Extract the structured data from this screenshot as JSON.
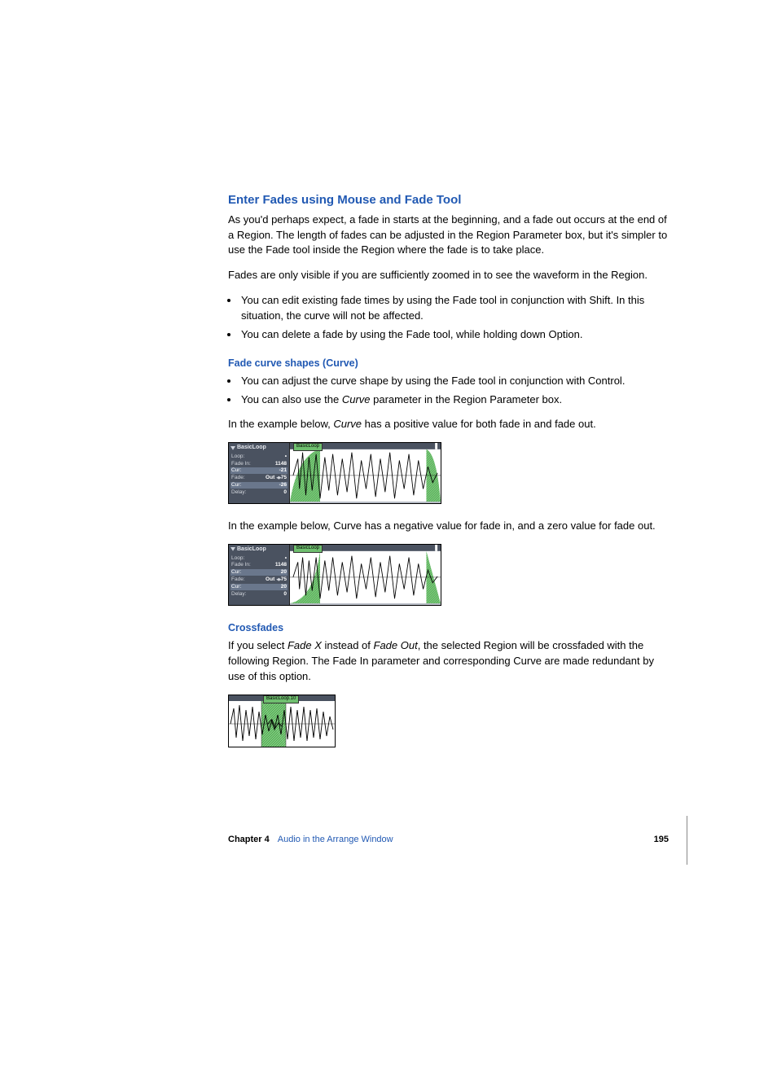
{
  "heading": "Enter Fades using Mouse and Fade Tool",
  "para1": "As you'd perhaps expect, a fade in starts at the beginning, and a fade out occurs at the end of a Region. The length of fades can be adjusted in the Region Parameter box, but it's simpler to use the Fade tool inside the Region where the fade is to take place.",
  "para2": "Fades are only visible if you are sufficiently zoomed in to see the waveform in the Region.",
  "bullets1": [
    "You can edit existing fade times by using the Fade tool in conjunction with Shift. In this situation, the curve will not be affected.",
    "You can delete a fade by using the Fade tool, while holding down Option."
  ],
  "sub1": "Fade curve shapes (Curve)",
  "bullets2_a": "You can adjust the curve shape by using the Fade tool in conjunction with Control.",
  "bullets2_b_pre": "You can also use the ",
  "bullets2_b_em": "Curve",
  "bullets2_b_post": " parameter in the Region Parameter box.",
  "para3_pre": "In the example below, ",
  "para3_em": "Curve",
  "para3_post": " has a positive value for both fade in and fade out.",
  "para4": "In the example below, Curve has a negative value for fade in, and a zero value for fade out.",
  "sub2": "Crossfades",
  "para5_a": "If you select ",
  "para5_b": "Fade X",
  "para5_c": " instead of ",
  "para5_d": "Fade Out",
  "para5_e": ", the selected Region will be crossfaded with the following Region. The Fade In parameter and corresponding Curve are made redundant by use of this option.",
  "fig1": {
    "panel_title": "BasicLoop",
    "region_tab": "BasicLoop",
    "rows": {
      "loop_l": "Loop:",
      "loop_v": "•",
      "fadein_l": "Fade In:",
      "fadein_v": "1148",
      "cur1_l": "Cur:",
      "cur1_v": "-21",
      "fade_l": "Fade:",
      "fade_v": "Out",
      "fade_num": "75",
      "cur2_l": "Cur:",
      "cur2_v": "-26",
      "delay_l": "Delay:",
      "delay_v": "0"
    }
  },
  "fig2": {
    "panel_title": "BasicLoop",
    "region_tab": "BasicLoop",
    "rows": {
      "loop_l": "Loop:",
      "loop_v": "•",
      "fadein_l": "Fade In:",
      "fadein_v": "1148",
      "cur1_l": "Cur:",
      "cur1_v": "20",
      "fade_l": "Fade:",
      "fade_v": "Out",
      "fade_num": "75",
      "cur2_l": "Cur:",
      "cur2_v": "20",
      "delay_l": "Delay:",
      "delay_v": "0"
    }
  },
  "fig3": {
    "region_tab": "BasicLoop.10"
  },
  "footer": {
    "chapter_num": "Chapter 4",
    "chapter_name": "Audio in the Arrange Window",
    "page_num": "195"
  }
}
